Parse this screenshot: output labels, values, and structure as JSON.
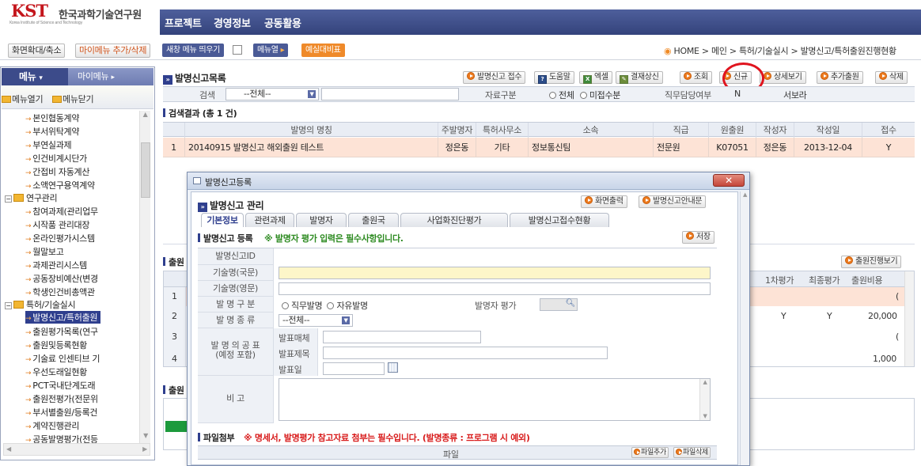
{
  "header": {
    "logo_text": "KST",
    "org_name": "한국과학기술연구원",
    "nav": [
      "프로젝트",
      "경영정보",
      "공동활용"
    ]
  },
  "subbar": {
    "zoom_btn": "화면확대/축소",
    "my_menu_add": "마이메뉴 추가/삭제",
    "new_window": "새창 메뉴 띄우기",
    "menu_select": "메뉴열",
    "budget_btn": "예실대비표",
    "breadcrumb": "HOME > 메인 > 특허/기술실시 > 발명신고/특허출원진행현황"
  },
  "sidebar": {
    "tab_menu": "메뉴",
    "tab_my": "마이메뉴",
    "open_all": "메뉴열기",
    "close_all": "메뉴닫기",
    "items": [
      {
        "label": "본인협동계약",
        "type": "leaf"
      },
      {
        "label": "부서위탁계약",
        "type": "leaf"
      },
      {
        "label": "부연실과제",
        "type": "leaf"
      },
      {
        "label": "인건비계시단가",
        "type": "leaf"
      },
      {
        "label": "간접비 자동계산",
        "type": "leaf"
      },
      {
        "label": "소액연구용역계약",
        "type": "leaf"
      },
      {
        "label": "연구관리",
        "type": "folder"
      },
      {
        "label": "참여과제(관리업무",
        "type": "leaf"
      },
      {
        "label": "시작품 관리대장",
        "type": "leaf"
      },
      {
        "label": "온라인평가시스템",
        "type": "leaf"
      },
      {
        "label": "월말보고",
        "type": "leaf"
      },
      {
        "label": "과제관리시스템",
        "type": "leaf"
      },
      {
        "label": "공동장비예산(변경",
        "type": "leaf"
      },
      {
        "label": "학생인건비총액관",
        "type": "leaf"
      },
      {
        "label": "특허/기술실시",
        "type": "folder"
      },
      {
        "label": "발명신고/특허출원",
        "type": "selected"
      },
      {
        "label": "출원평가목록(연구",
        "type": "leaf"
      },
      {
        "label": "출원및등록현황",
        "type": "leaf"
      },
      {
        "label": "기술료 인센티브 기",
        "type": "leaf"
      },
      {
        "label": "우선도래일현황",
        "type": "leaf"
      },
      {
        "label": "PCT국내단계도래",
        "type": "leaf"
      },
      {
        "label": "출원전평가(전문위",
        "type": "leaf"
      },
      {
        "label": "부서별출원/등록건",
        "type": "leaf"
      },
      {
        "label": "계약진행관리",
        "type": "leaf"
      },
      {
        "label": "공동발명평가(전등",
        "type": "leaf"
      }
    ]
  },
  "main": {
    "title": "발명신고목록",
    "toolbar": [
      "발명신고 접수",
      "도움말",
      "엑셀",
      "결재상신",
      "조회",
      "신규",
      "상세보기",
      "추가출원",
      "삭제"
    ],
    "search": {
      "label": "검색",
      "select": "--전체--",
      "type_label": "자료구분",
      "radio_all": "전체",
      "radio_unsubmitted": "미접수분",
      "person_label": "직무담당여부",
      "person_value": "N",
      "person_name": "서보라"
    },
    "results_title": "검색결과 (총 1 건)",
    "columns": [
      "발명의 명칭",
      "주발명자",
      "특허사무소",
      "소속",
      "직급",
      "원출원",
      "작성자",
      "작성일",
      "접수"
    ],
    "rows": [
      {
        "no": "1",
        "cells": [
          "20140915 발명신고 해외출원 테스트",
          "정은동",
          "기타",
          "정보통신팀",
          "전문원",
          "K07051",
          "정은동",
          "2013-12-04",
          "Y"
        ]
      }
    ],
    "section2_title": "출원",
    "section2_btn": "출원진행보기",
    "section2_cols": [
      "1차평가",
      "최종평가",
      "출원비용"
    ],
    "section2_rows": [
      {
        "no": "1",
        "a": "",
        "b": "",
        "c": "("
      },
      {
        "no": "2",
        "a": "Y",
        "b": "Y",
        "c": "20,000"
      },
      {
        "no": "3",
        "a": "",
        "b": "",
        "c": "("
      },
      {
        "no": "4",
        "a": "",
        "b": "",
        "c": "1,000"
      }
    ],
    "section3_title": "출원"
  },
  "dialog": {
    "window_title": "발명신고등록",
    "heading": "발명신고 관리",
    "print_btn": "화면출력",
    "guide_btn": "발명신고안내문",
    "tabs": [
      "기본정보",
      "관련과제",
      "발명자",
      "출원국",
      "사업화진단평가",
      "발명신고접수현황"
    ],
    "register_title": "발명신고 등록",
    "register_note": "※ 발명자 평가 입력은 필수사항입니다.",
    "save_btn": "저장",
    "fields": {
      "id_label": "발명신고ID",
      "name_ko_label": "기술명(국문)",
      "name_en_label": "기술명(영문)",
      "type_label": "발 명 구 분",
      "type_opt1": "직무발명",
      "type_opt2": "자유발명",
      "eval_label": "발명자 평가",
      "kind_label": "발 명 종 류",
      "kind_value": "--전체--",
      "pub_label": "발 명 의 공 표",
      "pub_sub": "(예정 포함)",
      "pub_media": "발표매체",
      "pub_title": "발표제목",
      "pub_date": "발표일",
      "note_label": "비 고"
    },
    "attach_title": "파일첨부",
    "attach_note": "※ 명세서, 발명평가 참고자료 첨부는 필수입니다. (발명종류 : 프로그램 시 예외)",
    "file_col": "파일",
    "file_add": "파일추가",
    "file_del": "파일삭제"
  },
  "colors": {
    "nav_bg": "#3f4f8f",
    "accent": "#e8771f",
    "highlight_row": "#fde3d6",
    "annotation": "#e0141e"
  }
}
